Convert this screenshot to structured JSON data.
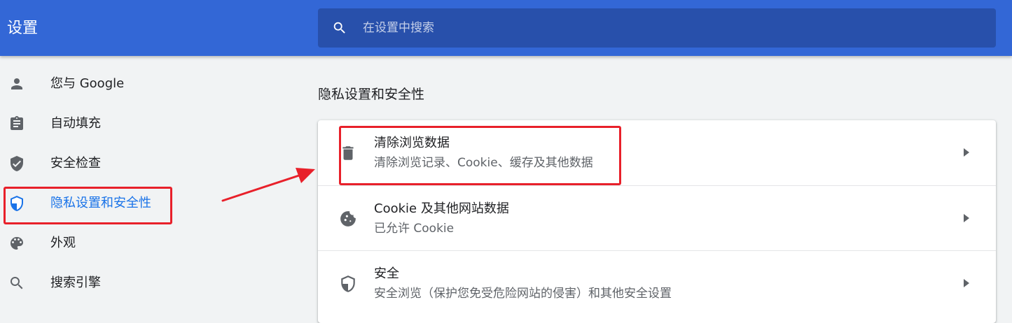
{
  "header": {
    "title": "设置",
    "search": {
      "placeholder": "在设置中搜索",
      "value": ""
    }
  },
  "sidebar": {
    "items": [
      {
        "label": "您与 Google",
        "icon": "person-icon"
      },
      {
        "label": "自动填充",
        "icon": "clipboard-icon"
      },
      {
        "label": "安全检查",
        "icon": "shield-check-icon"
      },
      {
        "label": "隐私设置和安全性",
        "icon": "shield-privacy-icon",
        "active": true
      },
      {
        "label": "外观",
        "icon": "palette-icon"
      },
      {
        "label": "搜索引擎",
        "icon": "search-icon"
      }
    ]
  },
  "main": {
    "section_title": "隐私设置和安全性",
    "rows": [
      {
        "title": "清除浏览数据",
        "subtitle": "清除浏览记录、Cookie、缓存及其他数据",
        "icon": "trash-icon"
      },
      {
        "title": "Cookie 及其他网站数据",
        "subtitle": "已允许 Cookie",
        "icon": "cookie-icon"
      },
      {
        "title": "安全",
        "subtitle": "安全浏览（保护您免受危险网站的侵害）和其他安全设置",
        "icon": "shield-icon"
      }
    ]
  },
  "colors": {
    "header": "#3367d6",
    "search_box": "#2850ab",
    "active_text": "#1a73e8",
    "annotation": "#e8202a"
  }
}
